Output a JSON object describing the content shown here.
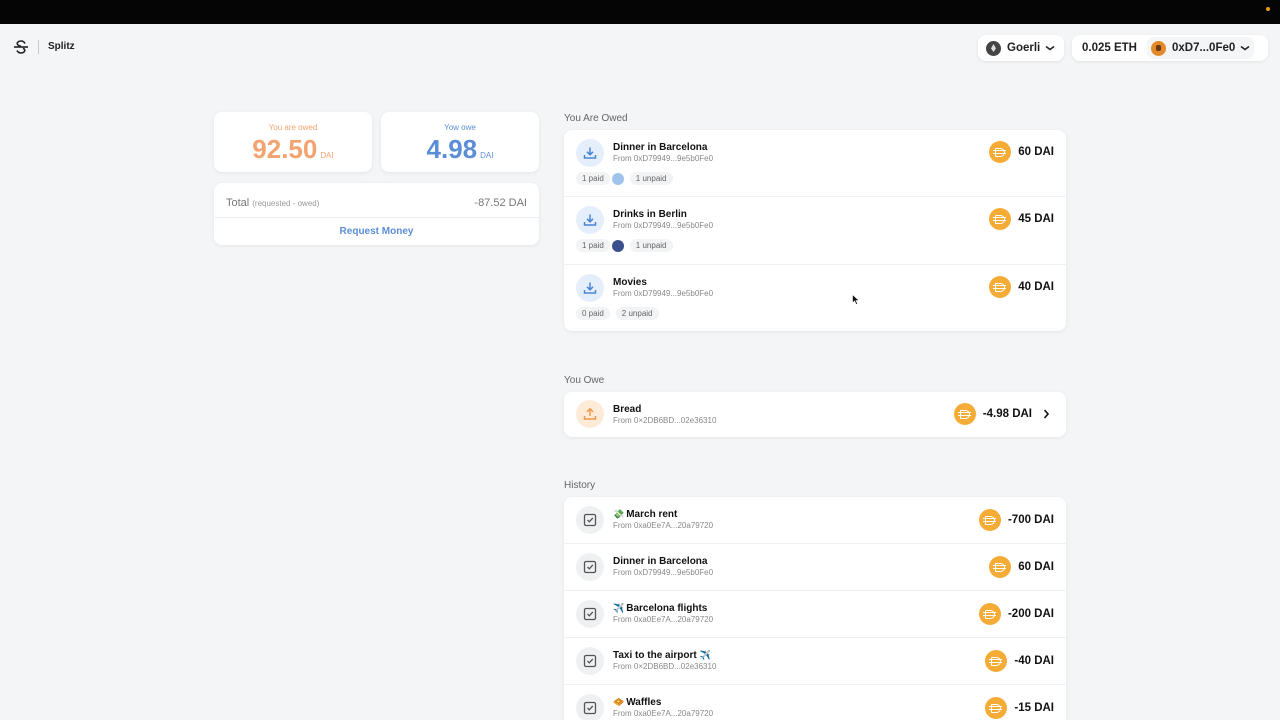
{
  "header": {
    "app_name": "Splitz",
    "network": "Goerli",
    "balance": "0.025 ETH",
    "account": "0xD7...0Fe0"
  },
  "summary": {
    "owed_label": "You are owed",
    "owed_amount": "92.50",
    "owed_unit": "DAI",
    "owe_label": "Yow owe",
    "owe_amount": "4.98",
    "owe_unit": "DAI",
    "total_label": "Total",
    "total_hint": "(requested - owed)",
    "total_value": "-87.52 DAI",
    "request_button": "Request Money"
  },
  "owed_section": {
    "title": "You Are Owed",
    "items": [
      {
        "title": "Dinner in Barcelona",
        "from": "From 0xD79949...9e5b0Fe0",
        "amount": "60 DAI",
        "paid": "1 paid",
        "unpaid": "1 unpaid"
      },
      {
        "title": "Drinks in Berlin",
        "from": "From 0xD79949...9e5b0Fe0",
        "amount": "45 DAI",
        "paid": "1 paid",
        "unpaid": "1 unpaid"
      },
      {
        "title": "Movies",
        "from": "From 0xD79949...9e5b0Fe0",
        "amount": "40 DAI",
        "paid": "0 paid",
        "unpaid": "2 unpaid"
      }
    ]
  },
  "owe_section": {
    "title": "You Owe",
    "items": [
      {
        "title": "Bread",
        "from": "From 0×2DB6BD...02e36310",
        "amount": "-4.98 DAI"
      }
    ]
  },
  "history_section": {
    "title": "History",
    "items": [
      {
        "emoji": "💸",
        "title": "March rent",
        "emoji_after": "",
        "from": "From 0xa0Ee7A...20a79720",
        "amount": "-700 DAI"
      },
      {
        "emoji": "",
        "title": "Dinner in Barcelona",
        "emoji_after": "",
        "from": "From 0xD79949...9e5b0Fe0",
        "amount": "60 DAI"
      },
      {
        "emoji": "✈️",
        "title": "Barcelona flights",
        "emoji_after": "",
        "from": "From 0xa0Ee7A...20a79720",
        "amount": "-200 DAI"
      },
      {
        "emoji": "",
        "title": "Taxi to the airport",
        "emoji_after": "✈️",
        "from": "From 0×2DB6BD...02e36310",
        "amount": "-40 DAI"
      },
      {
        "emoji": "🧇",
        "title": "Waffles",
        "emoji_after": "",
        "from": "From 0xa0Ee7A...20a79720",
        "amount": "-15 DAI"
      }
    ]
  },
  "colors": {
    "owed_accent": "#f2a36f",
    "owe_accent": "#5c8ed8",
    "dai_coin": "#f5ac37"
  }
}
